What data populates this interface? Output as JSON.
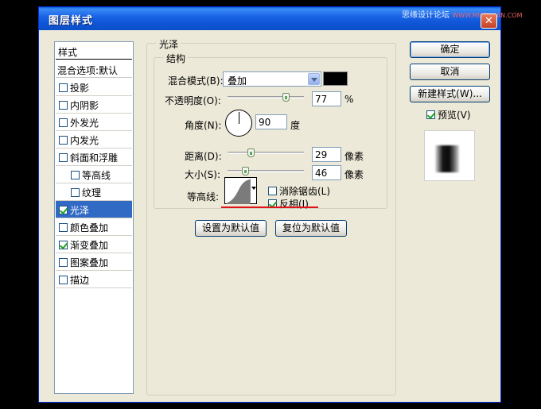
{
  "window": {
    "title": "图层样式"
  },
  "watermark": {
    "main": "思缘设计论坛",
    "sub": "WWW.MISSYUAN.COM"
  },
  "sidebar": {
    "header": "样式",
    "blend_options": "混合选项:默认",
    "items": [
      {
        "label": "投影",
        "checked": false,
        "sub": false,
        "selected": false
      },
      {
        "label": "内阴影",
        "checked": false,
        "sub": false,
        "selected": false
      },
      {
        "label": "外发光",
        "checked": false,
        "sub": false,
        "selected": false
      },
      {
        "label": "内发光",
        "checked": false,
        "sub": false,
        "selected": false
      },
      {
        "label": "斜面和浮雕",
        "checked": false,
        "sub": false,
        "selected": false
      },
      {
        "label": "等高线",
        "checked": false,
        "sub": true,
        "selected": false
      },
      {
        "label": "纹理",
        "checked": false,
        "sub": true,
        "selected": false
      },
      {
        "label": "光泽",
        "checked": true,
        "sub": false,
        "selected": true
      },
      {
        "label": "颜色叠加",
        "checked": false,
        "sub": false,
        "selected": false
      },
      {
        "label": "渐变叠加",
        "checked": true,
        "sub": false,
        "selected": false
      },
      {
        "label": "图案叠加",
        "checked": false,
        "sub": false,
        "selected": false
      },
      {
        "label": "描边",
        "checked": false,
        "sub": false,
        "selected": false
      }
    ]
  },
  "satin": {
    "group_title": "光泽",
    "structure_title": "结构",
    "blend_mode_label": "混合模式(B):",
    "blend_mode_value": "叠加",
    "color": "#000000",
    "opacity_label": "不透明度(O):",
    "opacity_value": "77",
    "opacity_unit": "%",
    "angle_label": "角度(N):",
    "angle_value": "90",
    "angle_unit": "度",
    "distance_label": "距离(D):",
    "distance_value": "29",
    "distance_unit": "像素",
    "size_label": "大小(S):",
    "size_value": "46",
    "size_unit": "像素",
    "contour_label": "等高线:",
    "antialias_label": "消除锯齿(L)",
    "antialias_checked": false,
    "invert_label": "反相(I)",
    "invert_checked": true,
    "make_default_button": "设置为默认值",
    "reset_default_button": "复位为默认值"
  },
  "actions": {
    "ok": "确定",
    "cancel": "取消",
    "new_style": "新建样式(W)...",
    "preview_label": "预览(V)",
    "preview_checked": true
  },
  "accent": {
    "selection": "#316ac5",
    "annotation": "#e1141c"
  }
}
